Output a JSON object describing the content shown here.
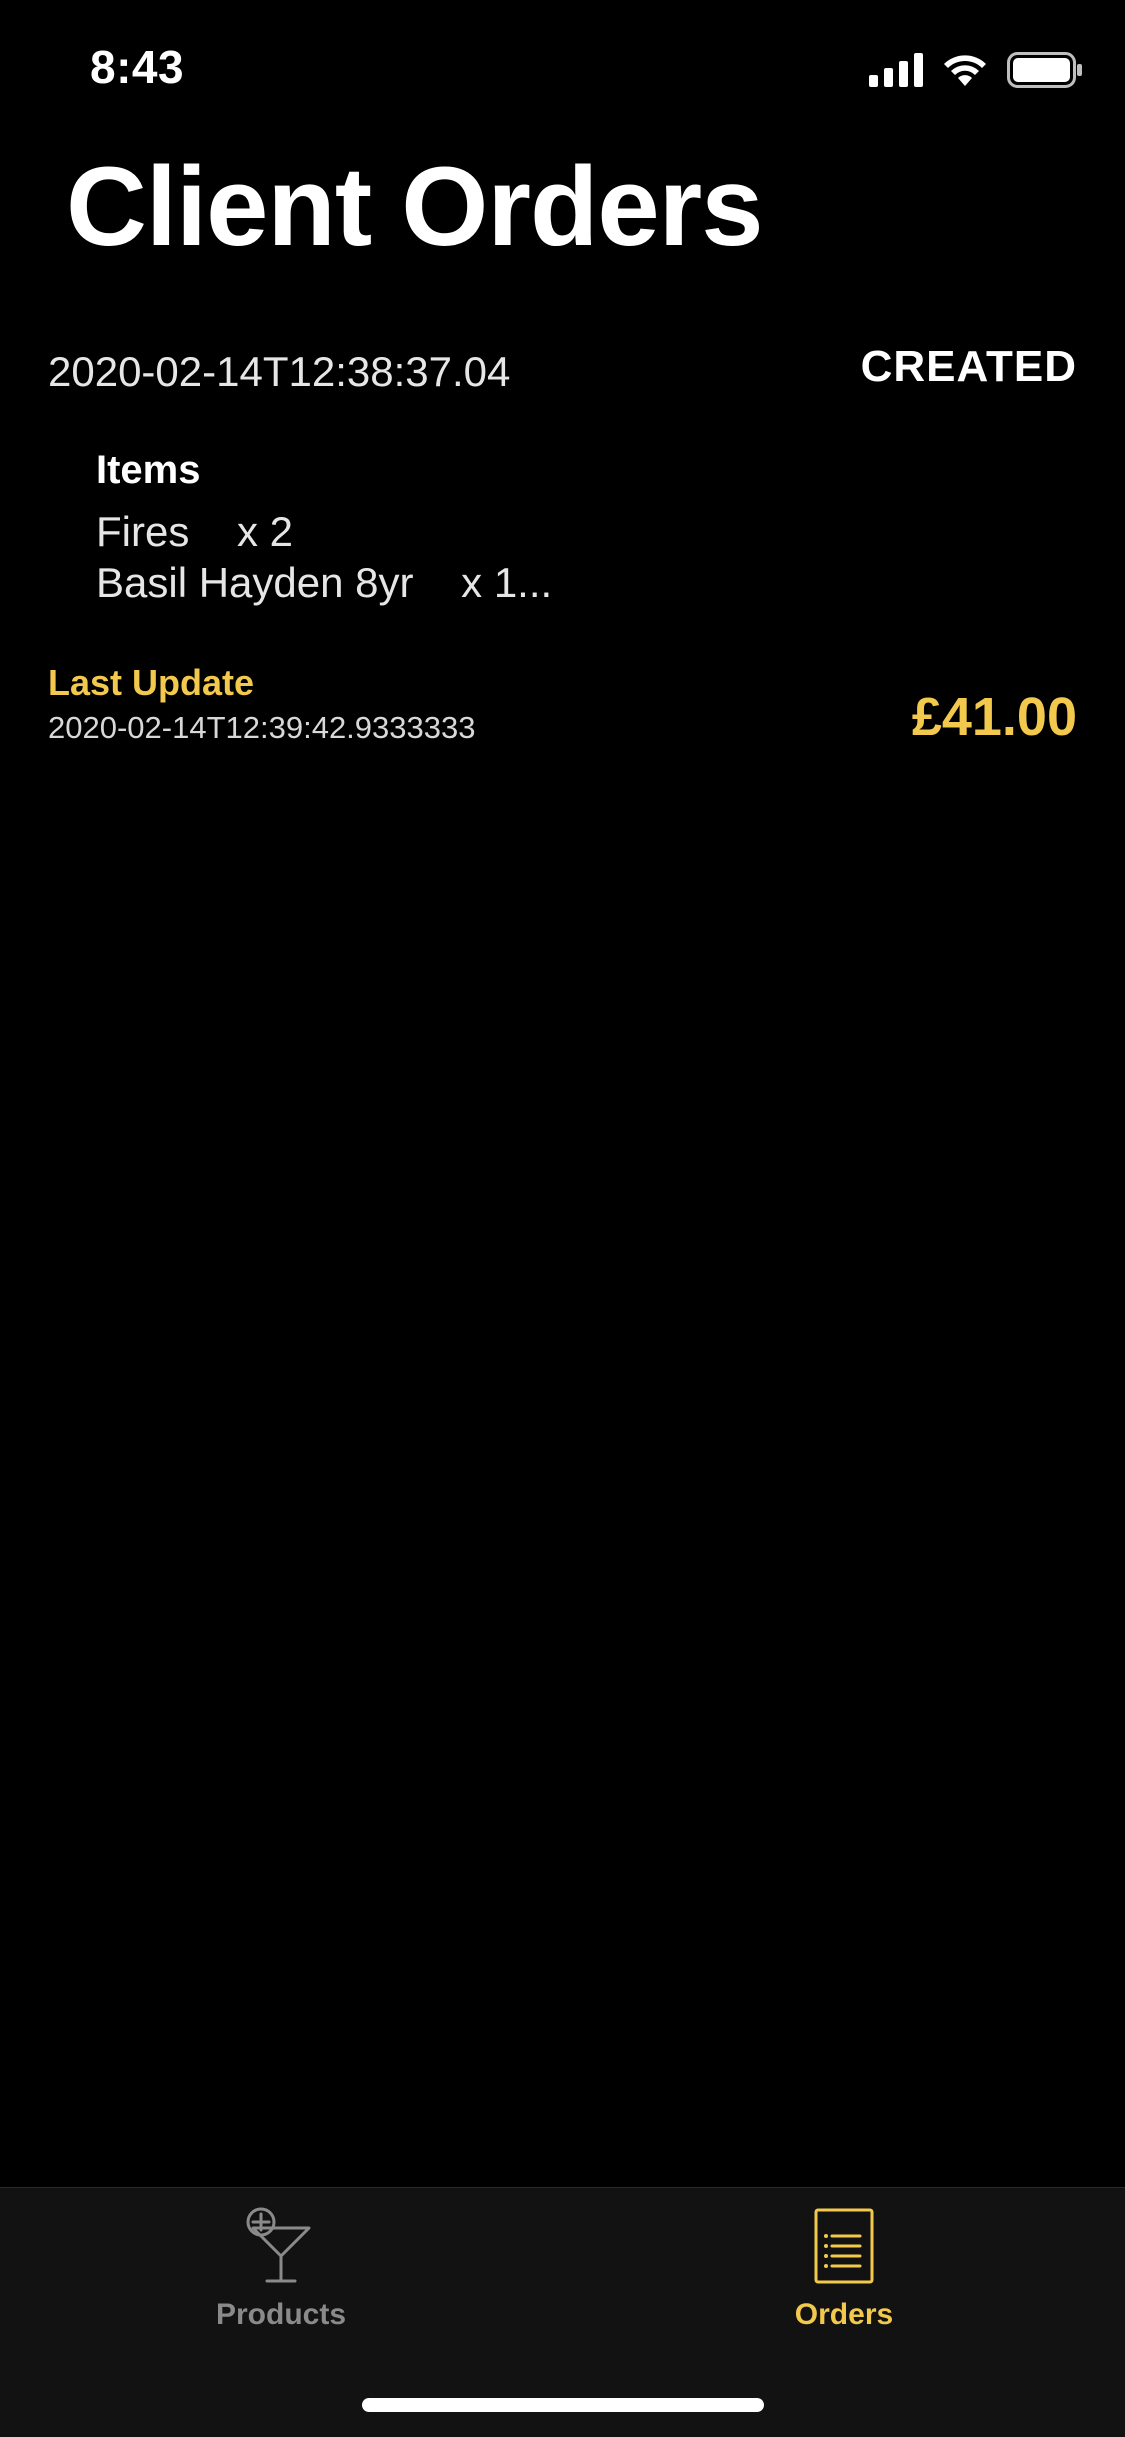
{
  "status_bar": {
    "time": "8:43",
    "icons": [
      "signal-icon",
      "wifi-icon",
      "battery-icon"
    ]
  },
  "page": {
    "title": "Client Orders"
  },
  "orders": [
    {
      "date": "2020-02-14T12:38:37.04",
      "status": "CREATED",
      "items_heading": "Items",
      "items": [
        {
          "name": "Fires",
          "qty": "x 2"
        },
        {
          "name": "Basil Hayden 8yr",
          "qty": "x 1..."
        }
      ],
      "last_update_label": "Last Update",
      "last_update_value": "2020-02-14T12:39:42.9333333",
      "price": "£41.00"
    }
  ],
  "tab_bar": {
    "tabs": [
      {
        "label": "Products",
        "icon": "cocktail-glass-icon",
        "selected": false
      },
      {
        "label": "Orders",
        "icon": "receipt-list-icon",
        "selected": true
      }
    ]
  },
  "colors": {
    "background": "#000000",
    "accent": "#f2c94c",
    "tab_bar_background": "#121212",
    "inactive_tab": "#8a8a8a",
    "text": "#ffffff"
  }
}
